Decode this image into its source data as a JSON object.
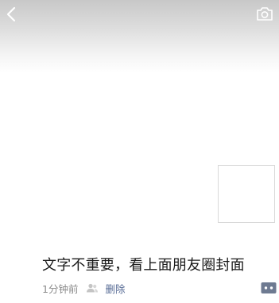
{
  "nav": {
    "back_icon": "chevron-left-icon",
    "camera_icon": "camera-icon"
  },
  "post": {
    "text": "文字不重要，看上面朋友圈封面",
    "time": "1分钟前",
    "author_icon": "people-icon",
    "delete_label": "删除",
    "more_icon": "comment-more-icon"
  },
  "colors": {
    "link": "#576b95",
    "meta_text": "#8a8a8a",
    "more_button": "#6e7a91"
  }
}
